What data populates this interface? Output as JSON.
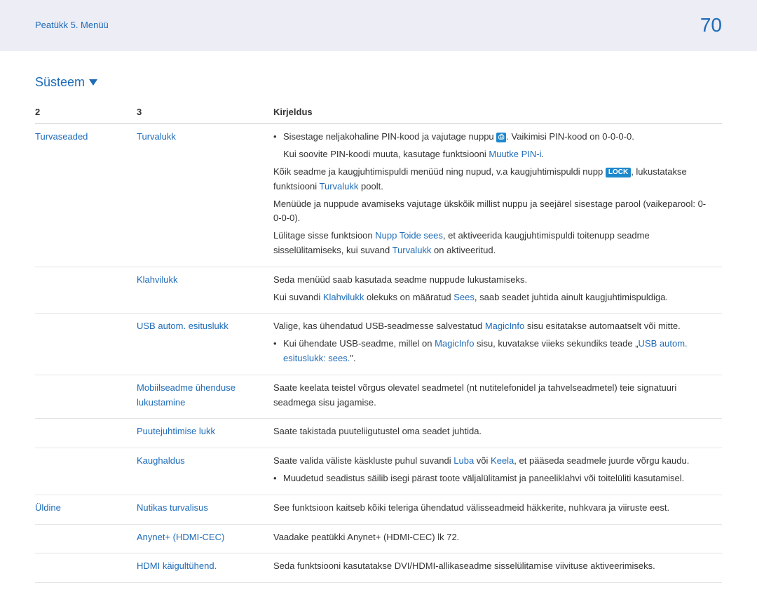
{
  "header": {
    "chapter": "Peatükk 5. Menüü",
    "page": "70"
  },
  "section": "Süsteem",
  "table": {
    "h1": "2",
    "h2": "3",
    "h3": "Kirjeldus",
    "rows": {
      "r1": {
        "col1": "Turvaseaded",
        "col2": "Turvalukk",
        "bullet1a": "Sisestage neljakohaline PIN-kood ja vajutage nuppu ",
        "bullet1b": ". Vaikimisi PIN-kood on 0-0-0-0.",
        "note1a": "Kui soovite PIN-koodi muuta, kasutage funktsiooni ",
        "note1b": "Muutke PIN-i",
        "note1c": ".",
        "p1a": "Kõik seadme ja kaugjuhtimispuldi menüüd ning nupud, v.a kaugjuhtimispuldi nupp ",
        "p1b": ", lukustatakse funktsiooni ",
        "p1c": "Turvalukk",
        "p1d": " poolt.",
        "p2": "Menüüde ja nuppude avamiseks vajutage ükskõik millist nuppu ja seejärel sisestage parool (vaikeparool: 0-0-0-0).",
        "p3a": "Lülitage sisse funktsioon ",
        "p3b": "Nupp Toide sees",
        "p3c": ", et aktiveerida kaugjuhtimispuldi toitenupp seadme sisselülitamiseks, kui suvand ",
        "p3d": "Turvalukk",
        "p3e": " on aktiveeritud.",
        "lock": "LOCK",
        "iconbox": "⎙"
      },
      "r2": {
        "col2": "Klahvilukk",
        "p1": "Seda menüüd saab kasutada seadme nuppude lukustamiseks.",
        "p2a": "Kui suvandi ",
        "p2b": "Klahvilukk",
        "p2c": " olekuks on määratud ",
        "p2d": "Sees",
        "p2e": ", saab seadet juhtida ainult kaugjuhtimispuldiga."
      },
      "r3": {
        "col2": "USB autom. esituslukk",
        "p1a": "Valige, kas ühendatud USB-seadmesse salvestatud ",
        "p1b": "MagicInfo",
        "p1c": " sisu esitatakse automaatselt või mitte.",
        "b1a": "Kui ühendate USB-seadme, millel on ",
        "b1b": "MagicInfo",
        "b1c": " sisu, kuvatakse viieks sekundiks teade „",
        "b1d": "USB autom. esituslukk: sees.",
        "b1e": "\"."
      },
      "r4": {
        "col2a": "Mobiilseadme ühenduse",
        "col2b": "lukustamine",
        "p1": "Saate keelata teistel võrgus olevatel seadmetel (nt nutitelefonidel ja tahvelseadmetel) teie signatuuri seadmega sisu jagamise."
      },
      "r5": {
        "col2": "Puutejuhtimise lukk",
        "p1": "Saate takistada puuteliigutustel oma seadet juhtida."
      },
      "r6": {
        "col2": "Kaughaldus",
        "p1a": "Saate valida väliste käskluste puhul suvandi ",
        "p1b": "Luba",
        "p1c": " või ",
        "p1d": "Keela",
        "p1e": ", et pääseda seadmele juurde võrgu kaudu.",
        "b1": "Muudetud seadistus säilib isegi pärast toote väljalülitamist ja paneeliklahvi või toitelüliti kasutamisel."
      },
      "r7": {
        "col1": "Üldine",
        "col2": "Nutikas turvalisus",
        "p1": "See funktsioon kaitseb kõiki teleriga ühendatud välisseadmeid häkkerite, nuhkvara ja viiruste eest."
      },
      "r8": {
        "col2": "Anynet+ (HDMI-CEC)",
        "p1": "Vaadake peatükki Anynet+ (HDMI-CEC) lk 72."
      },
      "r9": {
        "col2": "HDMI käigultühend.",
        "p1": "Seda funktsiooni kasutatakse DVI/HDMI-allikaseadme sisselülitamise viivituse aktiveerimiseks."
      }
    }
  }
}
